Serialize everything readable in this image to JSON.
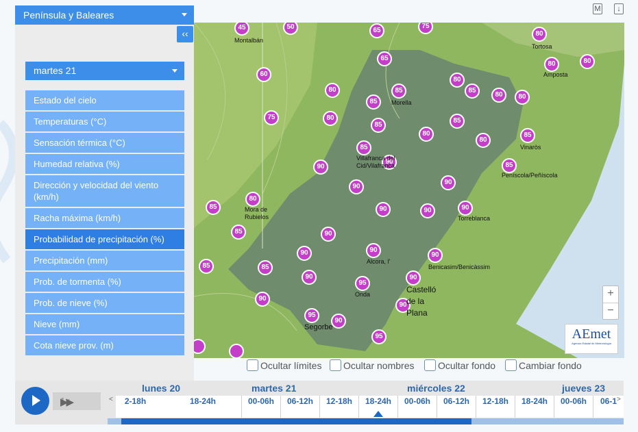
{
  "region_select": "Península y Baleares",
  "collapse": "‹‹",
  "day_select": "martes 21",
  "menu": [
    "Estado del cielo",
    "Temperaturas (°C)",
    "Sensación térmica (°C)",
    "Humedad relativa (%)",
    "Dirección y velocidad del viento (km/h)",
    "Racha máxima (km/h)",
    "Probabilidad de precipitación (%)",
    "Precipitación (mm)",
    "Prob. de tormenta (%)",
    "Prob. de nieve (%)",
    "Nieve (mm)",
    "Cota nieve prov. (m)"
  ],
  "active_menu": "Probabilidad de precipitación (%)",
  "top_icons": [
    "M",
    "↓"
  ],
  "map": {
    "markers": [
      "45",
      "50",
      "65",
      "75",
      "80",
      "80",
      "80",
      "65",
      "60",
      "80",
      "85",
      "85",
      "80",
      "85",
      "80",
      "80",
      "75",
      "80",
      "85",
      "85",
      "85",
      "80",
      "85",
      "90",
      "90",
      "80",
      "85",
      "90",
      "90",
      "80",
      "85",
      "90",
      "90",
      "90",
      "85",
      "90",
      "90",
      "85",
      "90",
      "90",
      "90",
      "85",
      "90",
      "90",
      "95",
      "95",
      "90",
      "90",
      "95"
    ],
    "towns": [
      "Montalbán",
      "Tortosa",
      "Amposta",
      "Morella",
      "Vinaròs",
      "Villafranca del Cid/Vilafranca",
      "Peníscola/Peñíscola",
      "Mora de Rubielos",
      "Torreblanca",
      "Alcora, l'",
      "Benicasim/Benicàssim",
      "Onda",
      "Castelló de la Plana",
      "Segorbe"
    ],
    "zoom_in": "+",
    "zoom_out": "−",
    "logo_text": "AEmet",
    "logo_subtext": "Agencia Estatal de Meteorología"
  },
  "options": [
    "Ocultar límites",
    "Ocultar nombres",
    "Ocultar fondo",
    "Cambiar fondo"
  ],
  "player": {
    "speed": "1x",
    "ff": "▶▶",
    "days": [
      "lunes 20",
      "martes 21",
      "miércoles 22",
      "jueves 23"
    ],
    "slots": [
      "2-18h",
      "18-24h",
      "00-06h",
      "06-12h",
      "12-18h",
      "18-24h",
      "00-06h",
      "06-12h",
      "12-18h",
      "18-24h",
      "00-06h",
      "06-1"
    ],
    "selected_slot": "18-24h",
    "nav_left": "<",
    "nav_right": ">"
  },
  "colors": {
    "accent": "#3d8ee8",
    "menu": "#74b1f7",
    "marker": "#c43fc8",
    "active": "#2f7ee3"
  }
}
